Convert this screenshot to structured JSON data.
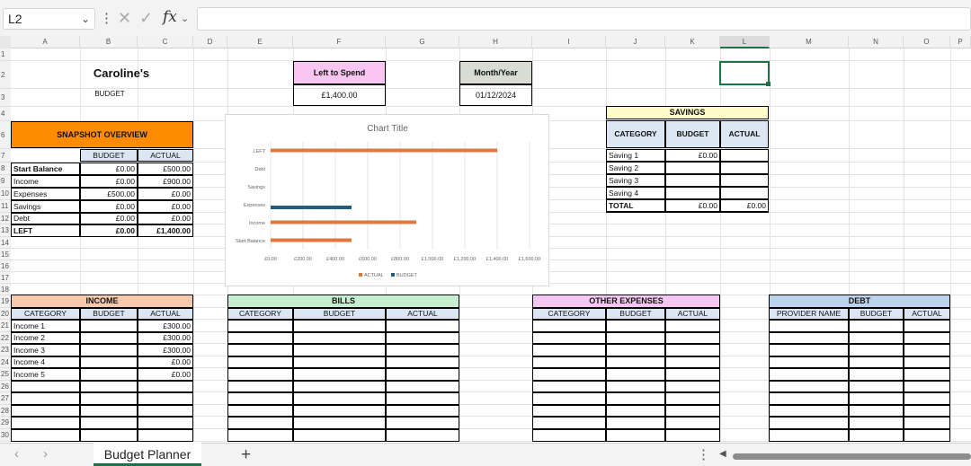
{
  "formula_bar": {
    "name_box": "L2",
    "fx_label": "fx",
    "formula": ""
  },
  "columns": [
    "A",
    "B",
    "C",
    "D",
    "E",
    "F",
    "G",
    "H",
    "I",
    "J",
    "K",
    "L",
    "M",
    "N",
    "O",
    "P"
  ],
  "rows": [
    "1",
    "2",
    "3",
    "4",
    "6",
    "7",
    "8",
    "9",
    "10",
    "11",
    "12",
    "13",
    "14",
    "15",
    "16",
    "17",
    "18",
    "19",
    "20",
    "21",
    "22",
    "23",
    "24",
    "25",
    "26",
    "27",
    "28",
    "29",
    "30"
  ],
  "header": {
    "owner": "Caroline's",
    "subtitle": "BUDGET",
    "left_to_spend_label": "Left to Spend",
    "left_to_spend_value": "£1,400.00",
    "month_label": "Month/Year",
    "month_value": "01/12/2024"
  },
  "snapshot": {
    "title": "SNAPSHOT OVERVIEW",
    "col_budget": "BUDGET",
    "col_actual": "ACTUAL",
    "rows": [
      {
        "label": "Start Balance",
        "budget": "£0.00",
        "actual": "£500.00"
      },
      {
        "label": "Income",
        "budget": "£0.00",
        "actual": "£900.00"
      },
      {
        "label": "Expenses",
        "budget": "£500.00",
        "actual": "£0.00"
      },
      {
        "label": "Savings",
        "budget": "£0.00",
        "actual": "£0.00"
      },
      {
        "label": "Debt",
        "budget": "£0.00",
        "actual": "£0.00"
      },
      {
        "label": "LEFT",
        "budget": "£0.00",
        "actual": "£1,400.00"
      }
    ]
  },
  "savings": {
    "title": "SAVINGS",
    "col_category": "CATEGORY",
    "col_budget": "BUDGET",
    "col_actual": "ACTUAL",
    "rows": [
      {
        "label": "Saving 1",
        "budget": "£0.00",
        "actual": ""
      },
      {
        "label": "Saving 2",
        "budget": "",
        "actual": ""
      },
      {
        "label": "Saving 3",
        "budget": "",
        "actual": ""
      },
      {
        "label": "Saving 4",
        "budget": "",
        "actual": ""
      },
      {
        "label": "TOTAL",
        "budget": "£0.00",
        "actual": "£0.00"
      }
    ]
  },
  "income": {
    "title": "INCOME",
    "col_category": "CATEGORY",
    "col_budget": "BUDGET",
    "col_actual": "ACTUAL",
    "rows": [
      {
        "label": "Income 1",
        "budget": "",
        "actual": "£300.00"
      },
      {
        "label": "Income 2",
        "budget": "",
        "actual": "£300.00"
      },
      {
        "label": "Income 3",
        "budget": "",
        "actual": "£300.00"
      },
      {
        "label": "Income 4",
        "budget": "",
        "actual": "£0.00"
      },
      {
        "label": "Income 5",
        "budget": "",
        "actual": "£0.00"
      }
    ]
  },
  "bills": {
    "title": "BILLS",
    "col_category": "CATEGORY",
    "col_budget": "BUDGET",
    "col_actual": "ACTUAL"
  },
  "other_expenses": {
    "title": "OTHER EXPENSES",
    "col_category": "CATEGORY",
    "col_budget": "BUDGET",
    "col_actual": "ACTUAL"
  },
  "debt": {
    "title": "DEBT",
    "col_provider": "PROVIDER NAME",
    "col_budget": "BUDGET",
    "col_actual": "ACTUAL"
  },
  "colors": {
    "snapshot_fill": "#ff8c00",
    "left_to_spend_fill": "#f8c6f0",
    "month_fill": "#d8dcd2",
    "savings_title_fill": "#fffbc9",
    "header_blue": "#dce6f2",
    "income_fill": "#f6c9ad",
    "bills_fill": "#c6efcf",
    "other_fill": "#f6c6f2",
    "debt_fill": "#bcd3ee",
    "series_actual": "#e2773c",
    "series_budget": "#1f5f86",
    "selection": "#1e7145"
  },
  "chart_data": {
    "type": "bar",
    "orientation": "horizontal",
    "title": "Chart Title",
    "categories": [
      "Start Balance",
      "Income",
      "Expenses",
      "Savings",
      "Debt",
      "LEFT"
    ],
    "series": [
      {
        "name": "ACTUAL",
        "values": [
          500,
          900,
          0,
          0,
          0,
          1400
        ]
      },
      {
        "name": "BUDGET",
        "values": [
          0,
          0,
          500,
          0,
          0,
          0
        ]
      }
    ],
    "xlim": [
      0,
      1600
    ],
    "xticks": [
      "£0.00",
      "£200.00",
      "£400.00",
      "£600.00",
      "£800.00",
      "£1,000.00",
      "£1,200.00",
      "£1,400.00",
      "£1,600.00"
    ],
    "grid": true,
    "legend": "bottom"
  },
  "sheet_tabs": {
    "active": "Budget Planner",
    "add": "+"
  }
}
